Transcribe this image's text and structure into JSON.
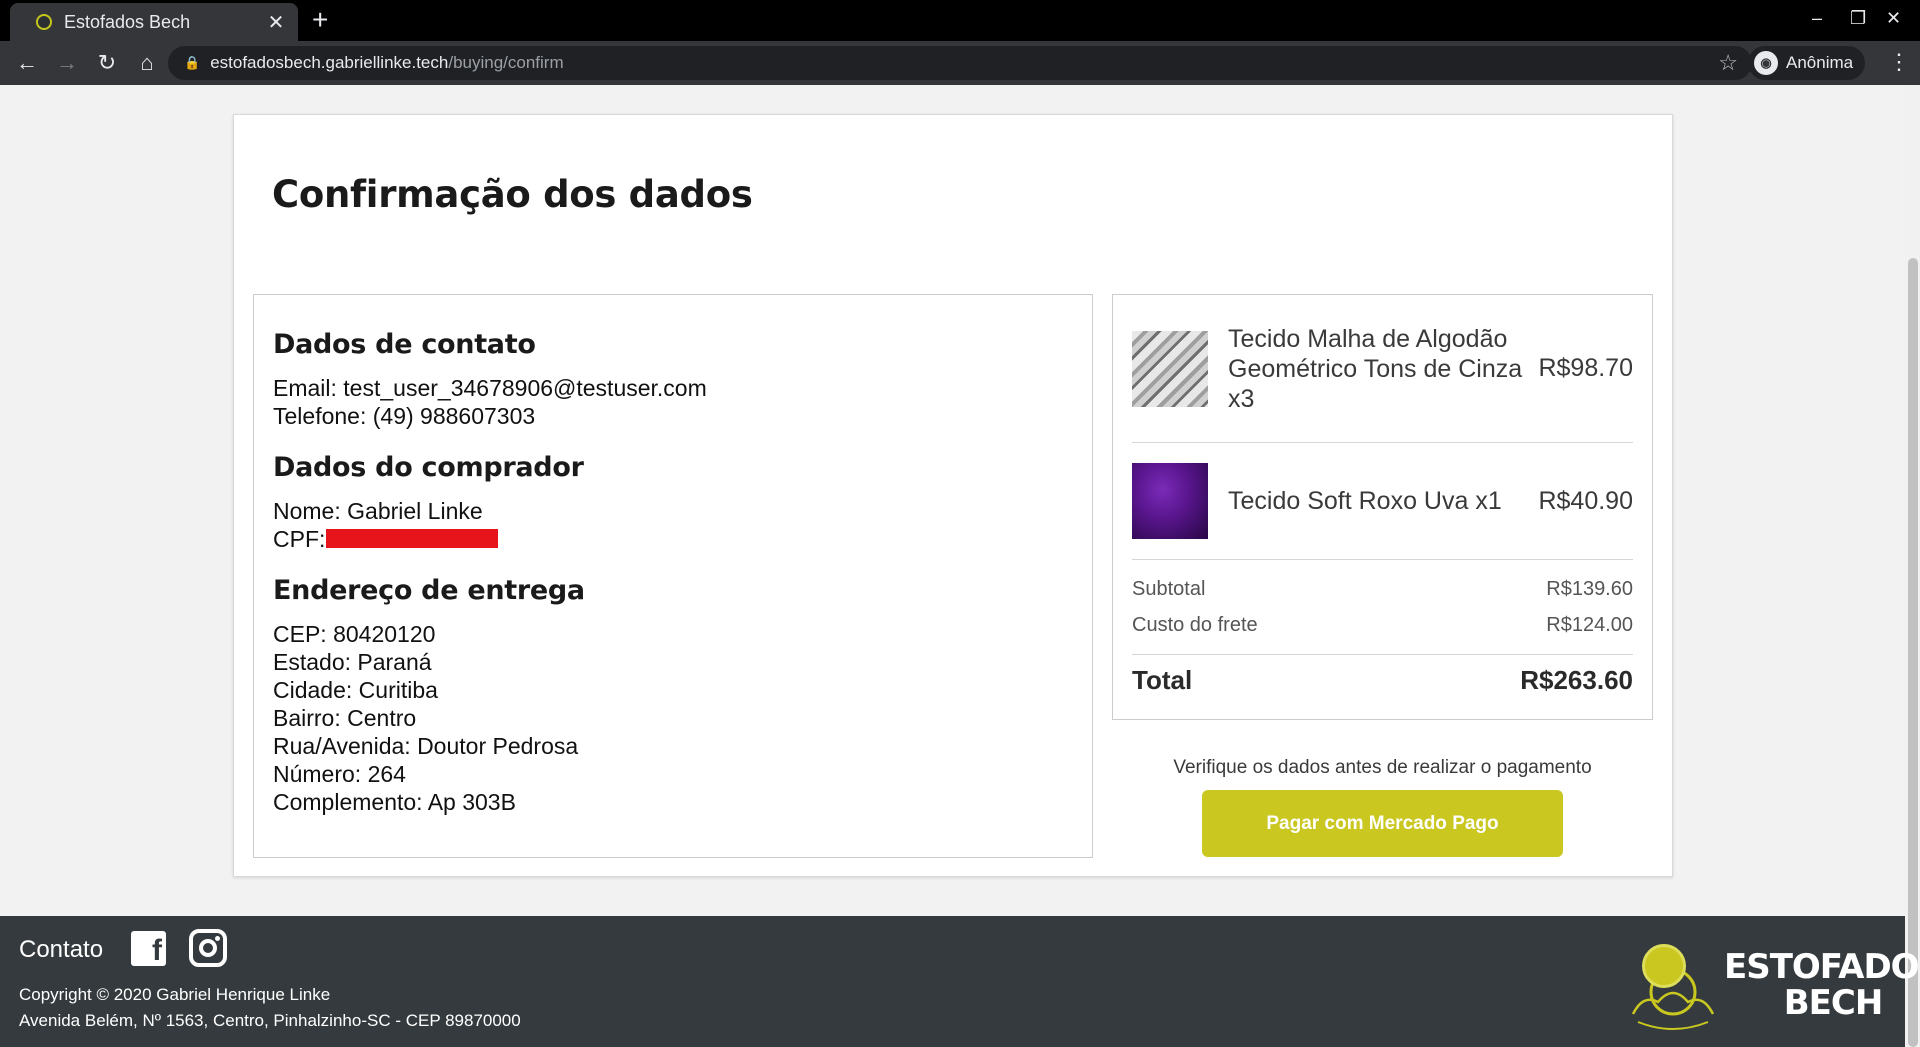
{
  "browser": {
    "tab_title": "Estofados Bech",
    "tab_close": "✕",
    "new_tab": "+",
    "url_host": "estofadosbech.gabriellinke.tech",
    "url_path": "/buying/confirm",
    "profile_label": "Anônima",
    "win_minimize": "–",
    "win_restore": "❐",
    "win_close": "✕"
  },
  "page": {
    "title": "Confirmação dos dados"
  },
  "contact": {
    "heading": "Dados de contato",
    "email": "Email: test_user_34678906@testuser.com",
    "phone": "Telefone: (49) 988607303"
  },
  "buyer": {
    "heading": "Dados do comprador",
    "name": "Nome: Gabriel Linke",
    "cpf_label": "CPF:"
  },
  "address": {
    "heading": "Endereço de entrega",
    "cep": "CEP: 80420120",
    "state": "Estado: Paraná",
    "city": "Cidade: Curitiba",
    "district": "Bairro: Centro",
    "street": "Rua/Avenida: Doutor Pedrosa",
    "number": "Número: 264",
    "complement": "Complemento: Ap 303B"
  },
  "order": {
    "items": [
      {
        "name": "Tecido Malha de Algodão Geométrico Tons de Cinza x3",
        "price": "R$98.70"
      },
      {
        "name": "Tecido Soft Roxo Uva x1",
        "price": "R$40.90"
      }
    ],
    "subtotal_label": "Subtotal",
    "subtotal_value": "R$139.60",
    "shipping_label": "Custo do frete",
    "shipping_value": "R$124.00",
    "total_label": "Total",
    "total_value": "R$263.60"
  },
  "payment": {
    "note": "Verifique os dados antes de realizar o pagamento",
    "button_label": "Pagar com Mercado Pago"
  },
  "footer": {
    "contact_label": "Contato",
    "copyright": "Copyright © 2020 Gabriel Henrique Linke",
    "address": "Avenida Belém, Nº 1563, Centro, Pinhalzinho-SC - CEP 89870000",
    "logo_line1": "ESTOFADOS",
    "logo_line2": "BECH"
  },
  "colors": {
    "accent": "#c9c720",
    "footer_bg": "#343a3d",
    "redaction": "#e8141b"
  },
  "icons": [
    "back-icon",
    "forward-icon",
    "reload-icon",
    "home-icon",
    "lock-icon",
    "star-icon",
    "incognito-icon",
    "menu-icon",
    "facebook-icon",
    "instagram-icon"
  ]
}
